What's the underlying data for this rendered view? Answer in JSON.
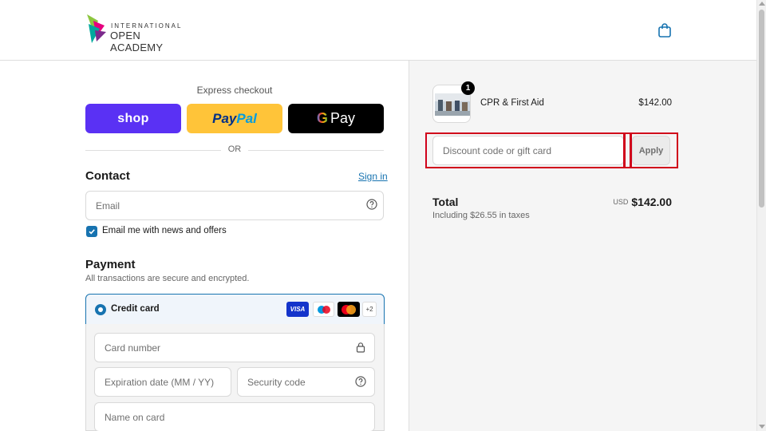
{
  "header": {
    "logo_small": "INTERNATIONAL",
    "logo_big": "OPEN ACADEMY",
    "cart_icon": "shopping-bag-icon"
  },
  "express": {
    "label": "Express checkout",
    "shop_label": "shop",
    "paypal_label_a": "Pay",
    "paypal_label_b": "Pal",
    "gpay_label_g": "G",
    "gpay_label": "Pay",
    "divider": "OR"
  },
  "contact": {
    "title": "Contact",
    "sign_in": "Sign in",
    "email_placeholder": "Email",
    "newsletter_label": "Email me with news and offers",
    "newsletter_checked": true
  },
  "payment": {
    "title": "Payment",
    "subtitle": "All transactions are secure and encrypted.",
    "method_label": "Credit card",
    "card_brands": [
      "VISA",
      "maestro",
      "mastercard",
      "+2"
    ],
    "card_number_placeholder": "Card number",
    "expiry_placeholder": "Expiration date (MM / YY)",
    "security_placeholder": "Security code",
    "name_placeholder": "Name on card"
  },
  "summary": {
    "product": {
      "name": "CPR & First Aid",
      "price": "$142.00",
      "quantity": "1"
    },
    "discount_placeholder": "Discount code or gift card",
    "apply_label": "Apply",
    "total_label": "Total",
    "tax_note": "Including $26.55 in taxes",
    "currency": "USD",
    "total_amount": "$142.00"
  },
  "colors": {
    "accent": "#1773b0",
    "shop_purple": "#5a31f4",
    "paypal_yellow": "#ffc439",
    "highlight_red": "#d0021b"
  }
}
